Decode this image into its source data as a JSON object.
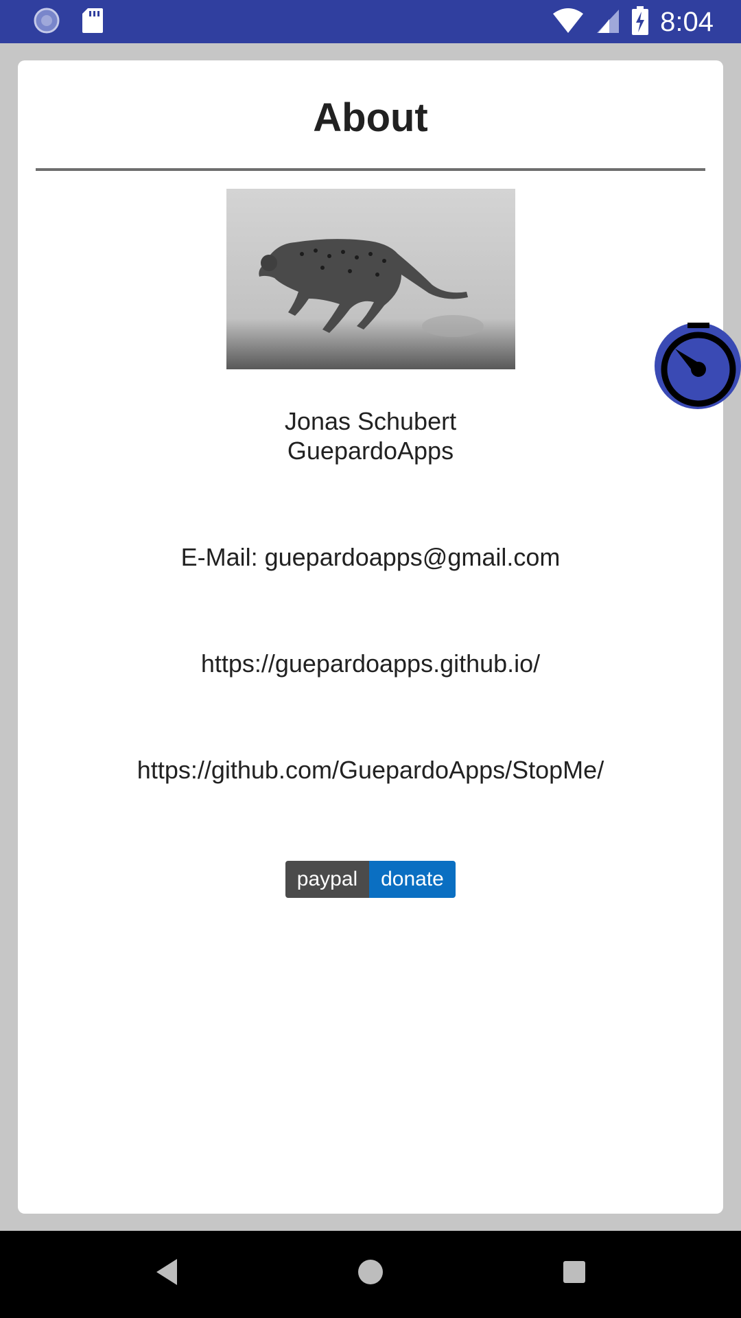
{
  "status_bar": {
    "time": "8:04",
    "icons": [
      "sync-icon",
      "sd-card-icon",
      "wifi-icon",
      "signal-icon",
      "battery-charging-icon"
    ],
    "background": "#303f9f"
  },
  "dialog": {
    "title": "About",
    "image": "cheetah-running-photo",
    "author_name": "Jonas Schubert",
    "company": "GuepardoApps",
    "email_line": "E-Mail: guepardoapps@gmail.com",
    "website": "https://guepardoapps.github.io/",
    "repository": "https://github.com/GuepardoApps/StopMe/",
    "paypal": {
      "left_label": "paypal",
      "right_label": "donate",
      "left_color": "#4b4b4b",
      "right_color": "#0a6fc2"
    }
  },
  "floating_button": {
    "icon": "stopwatch-icon",
    "color": "#3a4ab4"
  },
  "nav_bar": {
    "buttons": [
      "back-icon",
      "home-icon",
      "recents-icon"
    ]
  }
}
